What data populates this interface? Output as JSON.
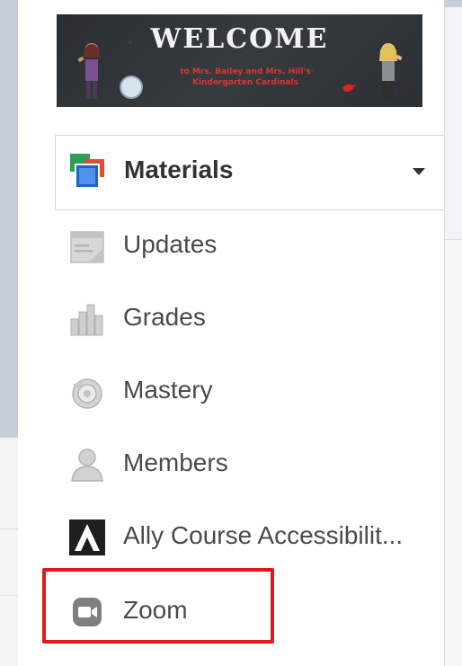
{
  "banner": {
    "title": "WELCOME",
    "subtitle": "to Mrs. Bailey and Mrs. Hill's Kindergarten Cardinals"
  },
  "materials": {
    "label": "Materials"
  },
  "nav": {
    "items": [
      {
        "label": "Updates",
        "icon": "updates-icon"
      },
      {
        "label": "Grades",
        "icon": "grades-icon"
      },
      {
        "label": "Mastery",
        "icon": "mastery-icon"
      },
      {
        "label": "Members",
        "icon": "members-icon"
      },
      {
        "label": "Ally Course Accessibilit...",
        "icon": "ally-icon"
      },
      {
        "label": "Zoom",
        "icon": "zoom-icon"
      }
    ]
  },
  "colors": {
    "highlight": "#e8151b",
    "text": "#4a4a4a",
    "background": "#c6cfd9"
  }
}
